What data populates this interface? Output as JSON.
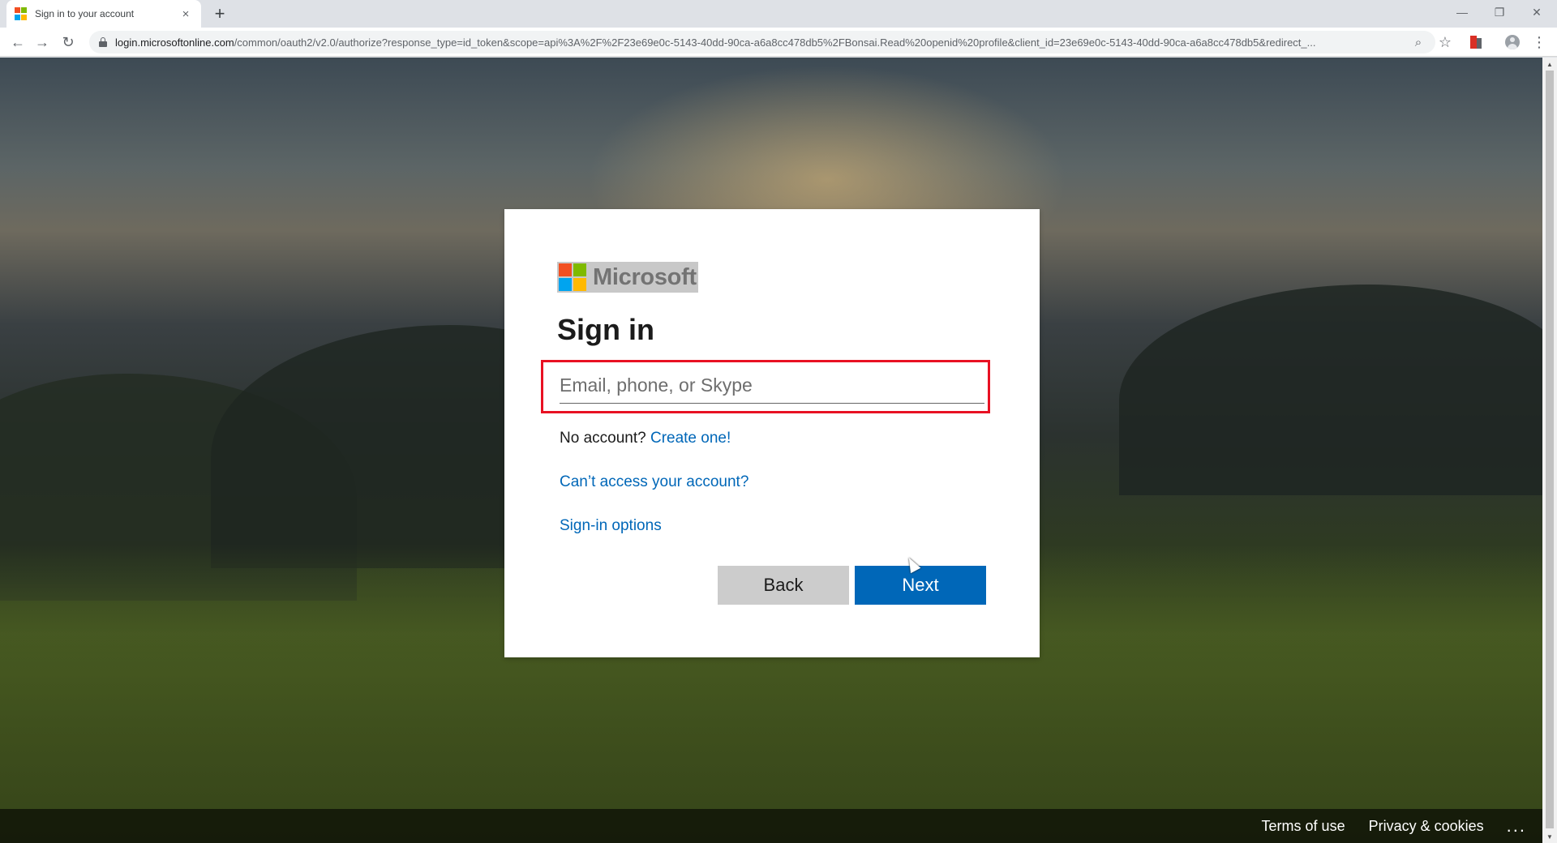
{
  "browser": {
    "tab_title": "Sign in to your account",
    "tab_close_glyph": "×",
    "new_tab_glyph": "+",
    "window_controls": {
      "minimize": "—",
      "restore": "❐",
      "close": "✕"
    },
    "nav": {
      "back": "←",
      "forward": "→",
      "reload": "↻"
    },
    "url_host": "login.microsoftonline.com",
    "url_path": "/common/oauth2/v2.0/authorize?response_type=id_token&scope=api%3A%2F%2F23e69e0c-5143-40dd-90ca-a6a8cc478db5%2FBonsai.Read%20openid%20profile&client_id=23e69e0c-5143-40dd-90ca-a6a8cc478db5&redirect_...",
    "zoom_glyph": "⌕",
    "star_glyph": "☆",
    "menu_glyph": "⋮"
  },
  "signin": {
    "logo_text": "Microsoft",
    "title": "Sign in",
    "email_placeholder": "Email, phone, or Skype",
    "email_value": "",
    "no_account_text": "No account?",
    "create_link": "Create one!",
    "cant_access_link": "Can’t access your account?",
    "signin_options_link": "Sign-in options",
    "back_button": "Back",
    "next_button": "Next"
  },
  "footer": {
    "terms": "Terms of use",
    "privacy": "Privacy & cookies",
    "more": "..."
  },
  "colors": {
    "accent": "#0067b8",
    "highlight_frame": "#e81123",
    "ms_red": "#f25022",
    "ms_green": "#7fba00",
    "ms_blue": "#00a4ef",
    "ms_yellow": "#ffb900"
  }
}
